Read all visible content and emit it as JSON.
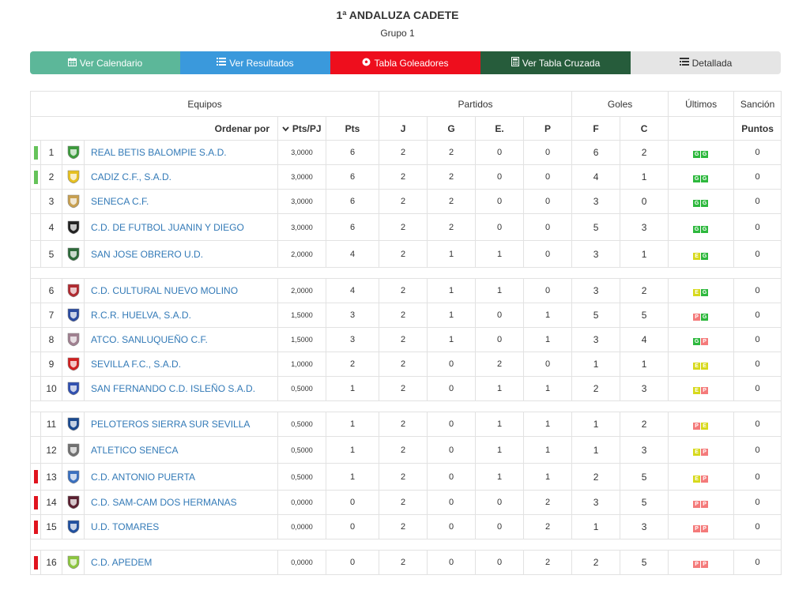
{
  "page": {
    "title": "1ª ANDALUZA CADETE",
    "subtitle": "Grupo 1"
  },
  "buttons": [
    {
      "label": "Ver Calendario",
      "icon": "calendar-icon",
      "color": "#5cb799"
    },
    {
      "label": "Ver Resultados",
      "icon": "list-icon",
      "color": "#3a99dc"
    },
    {
      "label": "Tabla Goleadores",
      "icon": "soccer-ball-icon",
      "color": "#ee0e1d"
    },
    {
      "label": "Ver Tabla Cruzada",
      "icon": "calculator-icon",
      "color": "#265c3b"
    },
    {
      "label": "Detallada",
      "icon": "table-icon",
      "color": "#e5e5e5"
    }
  ],
  "table": {
    "group_headers": {
      "equipos": "Equipos",
      "partidos": "Partidos",
      "goles": "Goles",
      "ultimos": "Últimos",
      "sancion": "Sanción"
    },
    "sub_headers": {
      "ordenar_por": "Ordenar por",
      "pts_pj": "Pts/PJ",
      "pts": "Pts",
      "j": "J",
      "g": "G",
      "e": "E.",
      "p": "P",
      "f": "F",
      "c": "C",
      "puntos": "Puntos"
    },
    "rows": [
      {
        "pos": "1",
        "marker": "green",
        "team": "REAL BETIS BALOMPIE S.A.D.",
        "pts_pj": "3,0000",
        "pts": "6",
        "j": "2",
        "g": "2",
        "e": "0",
        "p": "0",
        "f": "6",
        "c": "2",
        "last": [
          "G",
          "G"
        ],
        "sancion": "0",
        "crest": "#3c9a3c"
      },
      {
        "pos": "2",
        "marker": "green",
        "team": "CADIZ C.F., S.A.D.",
        "pts_pj": "3,0000",
        "pts": "6",
        "j": "2",
        "g": "2",
        "e": "0",
        "p": "0",
        "f": "4",
        "c": "1",
        "last": [
          "G",
          "G"
        ],
        "sancion": "0",
        "crest": "#e6c020"
      },
      {
        "pos": "3",
        "marker": "none",
        "team": "SENECA C.F.",
        "pts_pj": "3,0000",
        "pts": "6",
        "j": "2",
        "g": "2",
        "e": "0",
        "p": "0",
        "f": "3",
        "c": "0",
        "last": [
          "G",
          "G"
        ],
        "sancion": "0",
        "crest": "#c8a050"
      },
      {
        "pos": "4",
        "marker": "none",
        "team": "C.D. DE FUTBOL JUANIN Y DIEGO",
        "pts_pj": "3,0000",
        "pts": "6",
        "j": "2",
        "g": "2",
        "e": "0",
        "p": "0",
        "f": "5",
        "c": "3",
        "last": [
          "G",
          "G"
        ],
        "sancion": "0",
        "crest": "#222222"
      },
      {
        "pos": "5",
        "marker": "none",
        "team": "SAN JOSE OBRERO U.D.",
        "pts_pj": "2,0000",
        "pts": "4",
        "j": "2",
        "g": "1",
        "e": "1",
        "p": "0",
        "f": "3",
        "c": "1",
        "last": [
          "E",
          "G"
        ],
        "sancion": "0",
        "crest": "#2d6a3a"
      },
      {
        "pos": "6",
        "marker": "none",
        "team": "C.D. CULTURAL NUEVO MOLINO",
        "pts_pj": "2,0000",
        "pts": "4",
        "j": "2",
        "g": "1",
        "e": "1",
        "p": "0",
        "f": "3",
        "c": "2",
        "last": [
          "E",
          "G"
        ],
        "sancion": "0",
        "crest": "#b02a30"
      },
      {
        "pos": "7",
        "marker": "none",
        "team": "R.C.R. HUELVA, S.A.D.",
        "pts_pj": "1,5000",
        "pts": "3",
        "j": "2",
        "g": "1",
        "e": "0",
        "p": "1",
        "f": "5",
        "c": "5",
        "last": [
          "P",
          "G"
        ],
        "sancion": "0",
        "crest": "#2a4aa0"
      },
      {
        "pos": "8",
        "marker": "none",
        "team": "ATCO. SANLUQUEÑO C.F.",
        "pts_pj": "1,5000",
        "pts": "3",
        "j": "2",
        "g": "1",
        "e": "0",
        "p": "1",
        "f": "3",
        "c": "4",
        "last": [
          "G",
          "P"
        ],
        "sancion": "0",
        "crest": "#a08090"
      },
      {
        "pos": "9",
        "marker": "none",
        "team": "SEVILLA F.C., S.A.D.",
        "pts_pj": "1,0000",
        "pts": "2",
        "j": "2",
        "g": "0",
        "e": "2",
        "p": "0",
        "f": "1",
        "c": "1",
        "last": [
          "E",
          "E"
        ],
        "sancion": "0",
        "crest": "#d02020"
      },
      {
        "pos": "10",
        "marker": "none",
        "team": "SAN FERNANDO C.D. ISLEÑO S.A.D.",
        "pts_pj": "0,5000",
        "pts": "1",
        "j": "2",
        "g": "0",
        "e": "1",
        "p": "1",
        "f": "2",
        "c": "3",
        "last": [
          "E",
          "P"
        ],
        "sancion": "0",
        "crest": "#3050b0"
      },
      {
        "pos": "11",
        "marker": "none",
        "team": "PELOTEROS SIERRA SUR SEVILLA",
        "pts_pj": "0,5000",
        "pts": "1",
        "j": "2",
        "g": "0",
        "e": "1",
        "p": "1",
        "f": "1",
        "c": "2",
        "last": [
          "P",
          "E"
        ],
        "sancion": "0",
        "crest": "#1a4a90"
      },
      {
        "pos": "12",
        "marker": "none",
        "team": "ATLETICO SENECA",
        "pts_pj": "0,5000",
        "pts": "1",
        "j": "2",
        "g": "0",
        "e": "1",
        "p": "1",
        "f": "1",
        "c": "3",
        "last": [
          "E",
          "P"
        ],
        "sancion": "0",
        "crest": "#707070"
      },
      {
        "pos": "13",
        "marker": "red",
        "team": "C.D. ANTONIO PUERTA",
        "pts_pj": "0,5000",
        "pts": "1",
        "j": "2",
        "g": "0",
        "e": "1",
        "p": "1",
        "f": "2",
        "c": "5",
        "last": [
          "E",
          "P"
        ],
        "sancion": "0",
        "crest": "#3a70c0"
      },
      {
        "pos": "14",
        "marker": "red",
        "team": "C.D. SAM-CAM DOS HERMANAS",
        "pts_pj": "0,0000",
        "pts": "0",
        "j": "2",
        "g": "0",
        "e": "0",
        "p": "2",
        "f": "3",
        "c": "5",
        "last": [
          "P",
          "P"
        ],
        "sancion": "0",
        "crest": "#5a2030"
      },
      {
        "pos": "15",
        "marker": "red",
        "team": "U.D. TOMARES",
        "pts_pj": "0,0000",
        "pts": "0",
        "j": "2",
        "g": "0",
        "e": "0",
        "p": "2",
        "f": "1",
        "c": "3",
        "last": [
          "P",
          "P"
        ],
        "sancion": "0",
        "crest": "#2050a0"
      },
      {
        "pos": "16",
        "marker": "red",
        "team": "C.D. APEDEM",
        "pts_pj": "0,0000",
        "pts": "0",
        "j": "2",
        "g": "0",
        "e": "0",
        "p": "2",
        "f": "2",
        "c": "5",
        "last": [
          "P",
          "P"
        ],
        "sancion": "0",
        "crest": "#8cc63f"
      }
    ]
  }
}
